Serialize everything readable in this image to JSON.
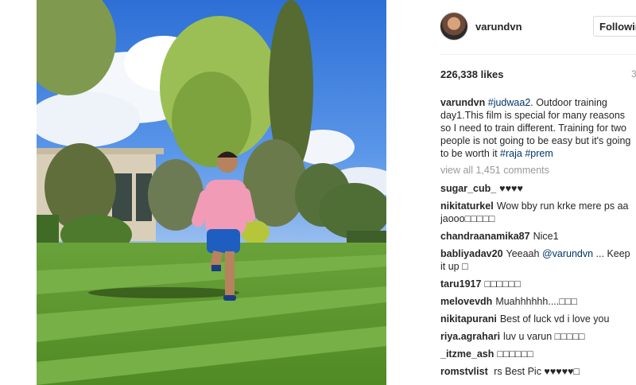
{
  "post": {
    "username": "varundvn",
    "follow_label": "Following",
    "likes": "226,338 likes",
    "time_stub": "3",
    "caption": {
      "username": "varundvn",
      "tag1": "#judwaa2",
      "text": ". Outdoor training day1.This film is special for many reasons so I need to train different. Training for two people is not going to be easy but it's going to be worth it ",
      "tag2": "#raja",
      "space": " ",
      "tag3": "#prem"
    },
    "view_all": "view all 1,451 comments"
  },
  "comments": [
    {
      "user": "sugar_cub_",
      "text": "♥♥♥♥"
    },
    {
      "user": "nikitaturkel",
      "text": "Wow bby run krke mere ps aa jaooo□□□□□"
    },
    {
      "user": "chandraanamika87",
      "text": "Nice1"
    },
    {
      "user": "babliyadav20",
      "text": "Yeeaah ",
      "mention": "@varundvn",
      "after": " ... Keep it up □"
    },
    {
      "user": "taru1917",
      "text": "□□□□□□"
    },
    {
      "user": "melovevdh",
      "text": "Muahhhhhh....□□□"
    },
    {
      "user": "nikitapurani",
      "text": "Best of luck vd i love you"
    },
    {
      "user": "riya.agrahari",
      "text": "luv u varun □□□□□"
    },
    {
      "user": "_itzme_ash",
      "text": "□□□□□□"
    },
    {
      "user": "romstvlist",
      "text": " rs Best Pic ♥♥♥♥♥□"
    }
  ],
  "colors": {
    "link": "#003569",
    "muted": "#999999",
    "border": "#dbdbdb"
  },
  "icons": [
    "profile-avatar"
  ]
}
